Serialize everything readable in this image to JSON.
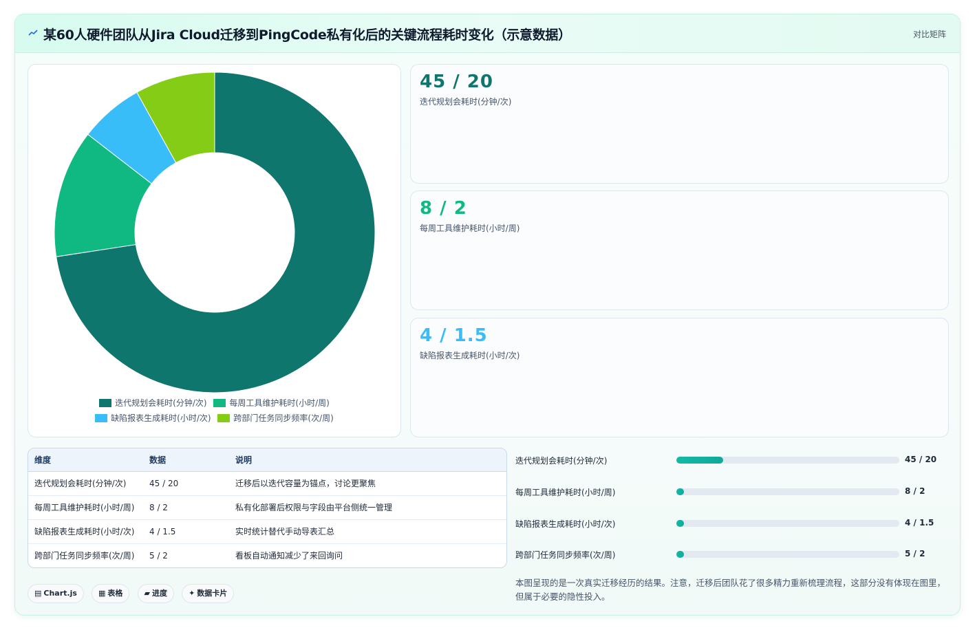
{
  "header": {
    "title": "某60人硬件团队从Jira Cloud迁移到PingCode私有化后的关键流程耗时变化（示意数据）",
    "badge": "对比矩阵",
    "icon": "trend-line-icon"
  },
  "colors": {
    "teal_dark": "#0f766e",
    "green": "#10b981",
    "sky": "#38bdf8",
    "lime": "#84cc16",
    "bar_fill": "#14b8a6"
  },
  "chart_data": {
    "type": "pie",
    "categories": [
      "迭代规划会耗时(分钟/次)",
      "每周工具维护耗时(小时/周)",
      "缺陷报表生成耗时(小时/次)",
      "跨部门任务同步频率(次/周)"
    ],
    "values": [
      45,
      8,
      4,
      5
    ],
    "colors": [
      "#0f766e",
      "#10b981",
      "#38bdf8",
      "#84cc16"
    ],
    "legend_position": "bottom"
  },
  "stats": [
    {
      "value": "45 / 20",
      "label": "迭代规划会耗时(分钟/次)",
      "color": "#0f766e"
    },
    {
      "value": "8 / 2",
      "label": "每周工具维护耗时(小时/周)",
      "color": "#10b981"
    },
    {
      "value": "4 / 1.5",
      "label": "缺陷报表生成耗时(小时/次)",
      "color": "#38bdf8"
    }
  ],
  "table": {
    "headers": [
      "维度",
      "数据",
      "说明"
    ],
    "rows": [
      [
        "迭代规划会耗时(分钟/次)",
        "45 / 20",
        "迁移后以迭代容量为锚点，讨论更聚焦"
      ],
      [
        "每周工具维护耗时(小时/周)",
        "8 / 2",
        "私有化部署后权限与字段由平台侧统一管理"
      ],
      [
        "缺陷报表生成耗时(小时/次)",
        "4 / 1.5",
        "实时统计替代手动导表汇总"
      ],
      [
        "跨部门任务同步频率(次/周)",
        "5 / 2",
        "看板自动通知减少了来回询问"
      ]
    ]
  },
  "progress": [
    {
      "label": "迭代规划会耗时(分钟/次)",
      "value_text": "45 / 20",
      "fraction": 0.21
    },
    {
      "label": "每周工具维护耗时(小时/周)",
      "value_text": "8 / 2",
      "fraction": 0.02
    },
    {
      "label": "缺陷报表生成耗时(小时/次)",
      "value_text": "4 / 1.5",
      "fraction": 0.01
    },
    {
      "label": "跨部门任务同步频率(次/周)",
      "value_text": "5 / 2",
      "fraction": 0.01
    }
  ],
  "note": "本图呈现的是一次真实迁移经历的结果。注意，迁移后团队花了很多精力重新梳理流程，这部分没有体现在图里，但属于必要的隐性投入。",
  "chips": [
    {
      "icon": "▤",
      "label": "Chart.js"
    },
    {
      "icon": "▦",
      "label": "表格"
    },
    {
      "icon": "▰",
      "label": "进度"
    },
    {
      "icon": "✦",
      "label": "数据卡片"
    }
  ]
}
